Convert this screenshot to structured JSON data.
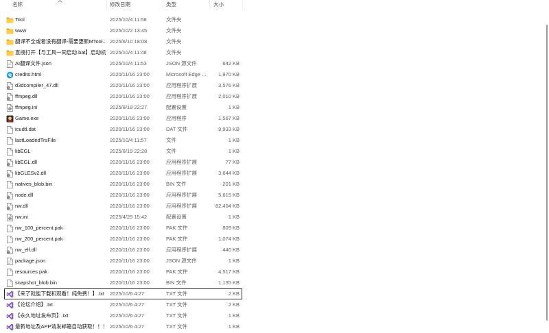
{
  "columns": {
    "name": "名称",
    "date": "修改日期",
    "type": "类型",
    "size": "大小"
  },
  "header": {
    "sort_icon": "sort-ascending-icon"
  },
  "colors": {
    "text_primary": "#1b1b1b",
    "text_secondary": "#616161",
    "header_text": "#4d4d4d",
    "folder": "#ffcd45",
    "folder_tab": "#e6a92b",
    "visual_studio": "#8661c5",
    "focus_border": "#2b2b2b",
    "scrollbar": "#9c9c9c"
  },
  "files": [
    {
      "name": "Tool",
      "date": "2025/10/4 11:58",
      "type": "文件夹",
      "icon": "folder-icon"
    },
    {
      "name": "www",
      "date": "2025/10/2 13:45",
      "type": "文件夹",
      "icon": "folder-icon"
    },
    {
      "name": "翻译不全或者没有翻译-需要更新MTool...",
      "date": "2025/6/10 18:08",
      "type": "文件夹",
      "icon": "folder-icon"
    },
    {
      "name": "直接打开【与工具一同启动.bat】启动机翻",
      "date": "2025/10/4 11:48",
      "type": "文件夹",
      "icon": "folder-icon"
    },
    {
      "name": "AI翻译文件.json",
      "date": "2025/10/4 11:53",
      "type": "JSON 源文件",
      "size": "642 KB",
      "icon": "json-file-icon"
    },
    {
      "name": "credits.html",
      "date": "2020/11/16 23:00",
      "type": "Microsoft Edge ...",
      "size": "1,970 KB",
      "icon": "edge-icon"
    },
    {
      "name": "d3dcompiler_47.dll",
      "date": "2020/11/16 23:00",
      "type": "应用程序扩展",
      "size": "3,576 KB",
      "icon": "dll-file-icon"
    },
    {
      "name": "ffmpeg.dll",
      "date": "2020/11/16 23:00",
      "type": "应用程序扩展",
      "size": "2,010 KB",
      "icon": "dll-file-icon"
    },
    {
      "name": "ffmpeg.ini",
      "date": "2025/8/19 22:27",
      "type": "配置设置",
      "size": "1 KB",
      "icon": "settings-file-icon"
    },
    {
      "name": "Game.exe",
      "date": "2020/11/16 23:00",
      "type": "应用程序",
      "size": "1,567 KB",
      "icon": "game-icon"
    },
    {
      "name": "icudtl.dat",
      "date": "2020/11/16 23:00",
      "type": "DAT 文件",
      "size": "9,933 KB",
      "icon": "file-icon"
    },
    {
      "name": "lastLoadedTrsFile",
      "date": "2025/10/4 11:57",
      "type": "文件",
      "size": "1 KB",
      "icon": "file-icon"
    },
    {
      "name": "libEGL",
      "date": "2025/8/19 22:28",
      "type": "文件",
      "size": "1 KB",
      "icon": "file-icon"
    },
    {
      "name": "libEGL.dll",
      "date": "2020/11/16 23:00",
      "type": "应用程序扩展",
      "size": "77 KB",
      "icon": "dll-file-icon"
    },
    {
      "name": "libGLESv2.dll",
      "date": "2020/11/16 23:00",
      "type": "应用程序扩展",
      "size": "3,644 KB",
      "icon": "dll-file-icon"
    },
    {
      "name": "natives_blob.bin",
      "date": "2020/11/16 23:00",
      "type": "BIN 文件",
      "size": "201 KB",
      "icon": "file-icon"
    },
    {
      "name": "node.dll",
      "date": "2020/11/16 23:00",
      "type": "应用程序扩展",
      "size": "5,615 KB",
      "icon": "dll-file-icon"
    },
    {
      "name": "nw.dll",
      "date": "2020/11/16 23:00",
      "type": "应用程序扩展",
      "size": "82,404 KB",
      "icon": "dll-file-icon"
    },
    {
      "name": "nw.ini",
      "date": "2025/4/25 15:42",
      "type": "配置设置",
      "size": "1 KB",
      "icon": "settings-file-icon"
    },
    {
      "name": "nw_100_percent.pak",
      "date": "2020/11/16 23:00",
      "type": "PAK 文件",
      "size": "809 KB",
      "icon": "file-icon"
    },
    {
      "name": "nw_200_percent.pak",
      "date": "2020/11/16 23:00",
      "type": "PAK 文件",
      "size": "1,074 KB",
      "icon": "file-icon"
    },
    {
      "name": "nw_elf.dll",
      "date": "2020/11/16 23:00",
      "type": "应用程序扩展",
      "size": "440 KB",
      "icon": "dll-file-icon"
    },
    {
      "name": "package.json",
      "date": "2020/11/16 23:00",
      "type": "JSON 源文件",
      "size": "1 KB",
      "icon": "json-file-icon"
    },
    {
      "name": "resources.pak",
      "date": "2020/11/16 23:00",
      "type": "PAK 文件",
      "size": "4,517 KB",
      "icon": "file-icon"
    },
    {
      "name": "snapshot_blob.bin",
      "date": "2020/11/16 23:00",
      "type": "BIN 文件",
      "size": "1,135 KB",
      "icon": "file-icon"
    },
    {
      "name": "【来了就能下载和观看！纯免费！】.txt",
      "date": "2025/10/6 4:27",
      "type": "TXT 文件",
      "size": "2 KB",
      "icon": "visual-studio-icon",
      "focused": true
    },
    {
      "name": "【论坛介绍】.txt",
      "date": "2025/10/6 4:27",
      "type": "TXT 文件",
      "size": "2 KB",
      "icon": "visual-studio-icon"
    },
    {
      "name": "【永久地址发布页】.txt",
      "date": "2025/10/6 4:27",
      "type": "TXT 文件",
      "size": "1 KB",
      "icon": "visual-studio-icon"
    },
    {
      "name": "最新地址及APP请发邮箱自动获取！！！...",
      "date": "2025/10/6 4:27",
      "type": "TXT 文件",
      "size": "1 KB",
      "icon": "visual-studio-icon"
    }
  ]
}
